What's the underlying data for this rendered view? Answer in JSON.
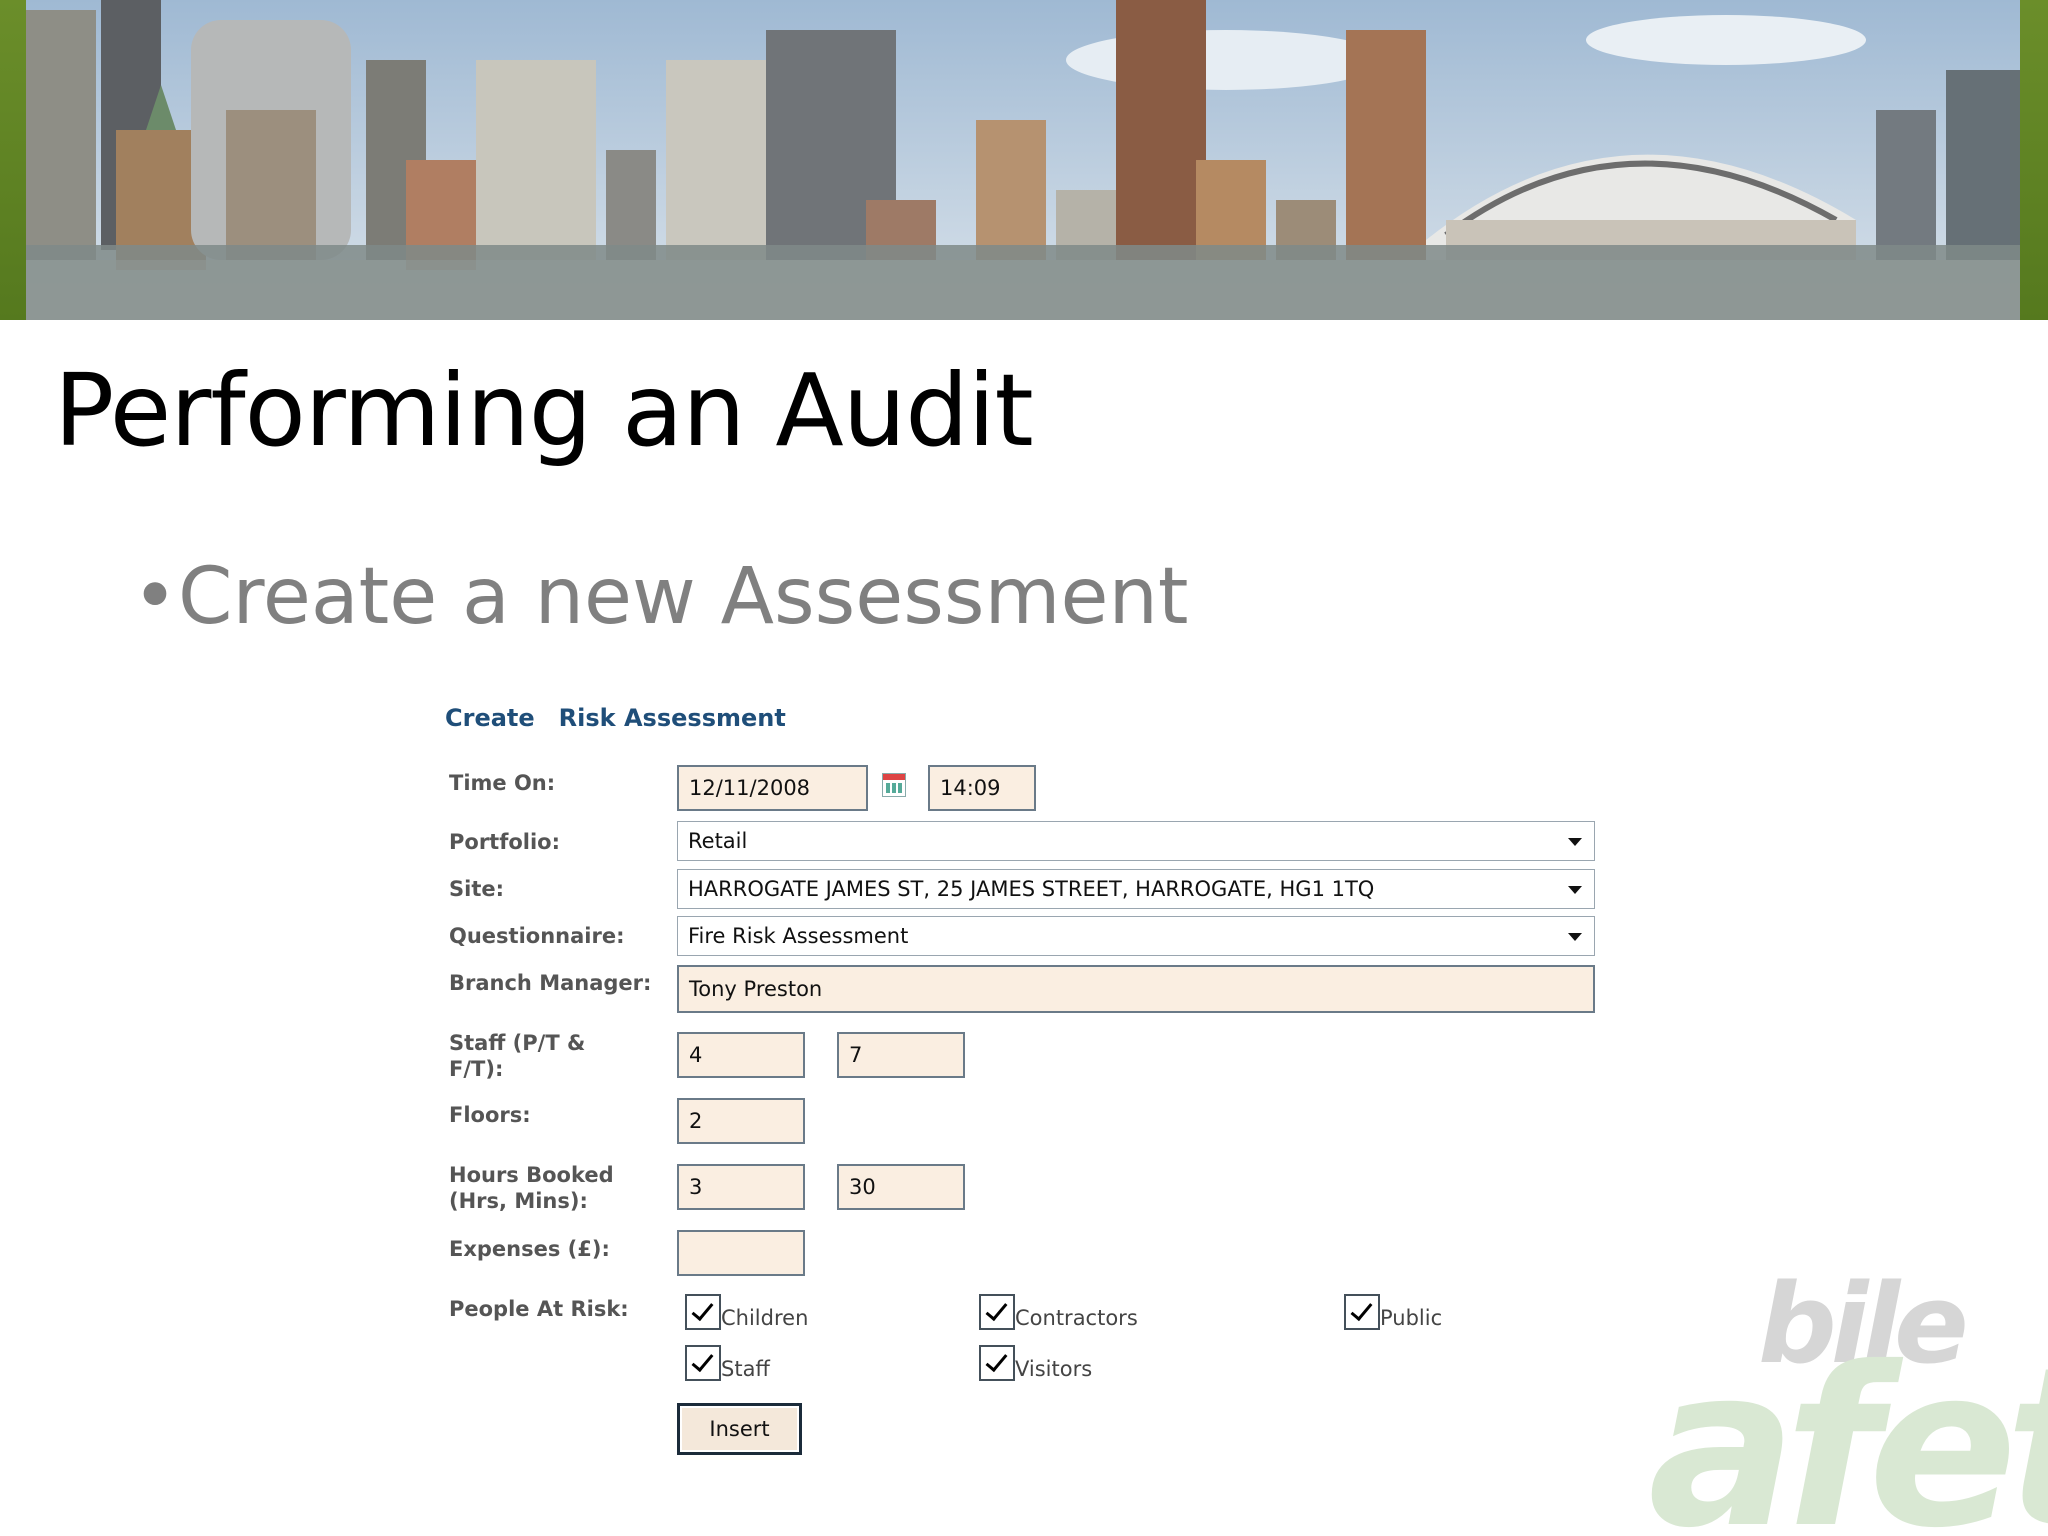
{
  "slide": {
    "title": "Performing an Audit",
    "bullet": "•Create a new Assessment"
  },
  "form": {
    "heading_action": "Create",
    "heading_subject": "Risk Assessment",
    "labels": {
      "time_on": "Time On:",
      "portfolio": "Portfolio:",
      "site": "Site:",
      "questionnaire": "Questionnaire:",
      "branch_manager": "Branch Manager:",
      "staff_line1": "Staff (P/T &",
      "staff_line2": "F/T):",
      "floors": "Floors:",
      "hours_line1": "Hours Booked",
      "hours_line2": "(Hrs, Mins):",
      "expenses": "Expenses (£):",
      "people_at_risk": "People At Risk:"
    },
    "values": {
      "date": "12/11/2008",
      "time": "14:09",
      "portfolio": "Retail",
      "site": "HARROGATE JAMES ST, 25 JAMES STREET, HARROGATE, HG1 1TQ",
      "questionnaire": "Fire Risk Assessment",
      "branch_manager": "Tony Preston",
      "staff_pt": "4",
      "staff_ft": "7",
      "floors": "2",
      "hours": "3",
      "mins": "30",
      "expenses": ""
    },
    "people_at_risk": [
      {
        "label": "Children",
        "checked": true
      },
      {
        "label": "Contractors",
        "checked": true
      },
      {
        "label": "Public",
        "checked": true
      },
      {
        "label": "Staff",
        "checked": true
      },
      {
        "label": "Visitors",
        "checked": true
      }
    ],
    "insert_label": "Insert"
  },
  "watermark": {
    "line1": "bile",
    "line2": "afety"
  },
  "colors": {
    "heading": "#1f4e79",
    "field_bg": "#faeee1",
    "banner_frame": "#5f8424"
  },
  "icons": [
    "calendar-icon",
    "dropdown-arrow-icon",
    "checkmark-icon"
  ]
}
